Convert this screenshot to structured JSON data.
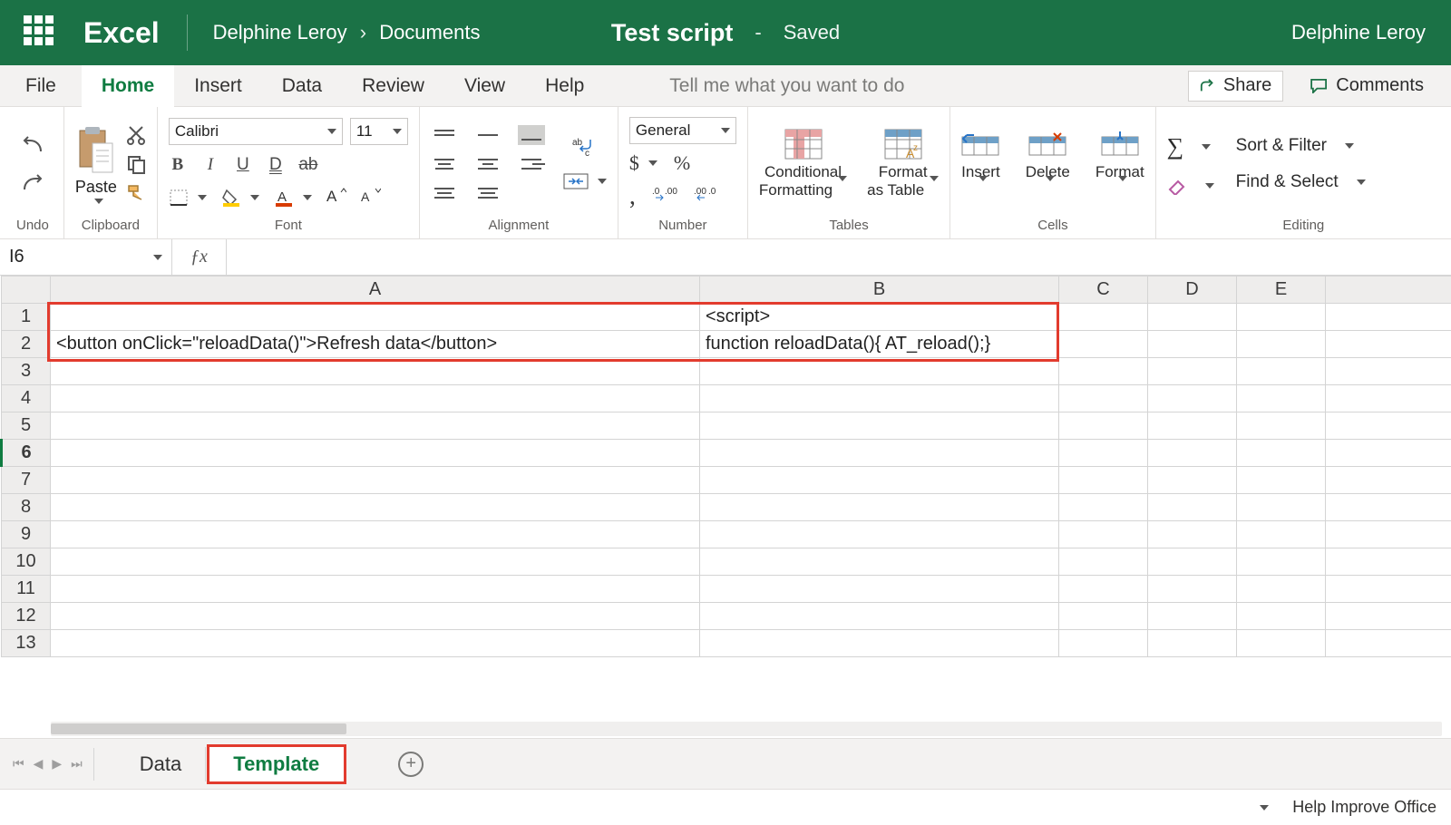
{
  "titlebar": {
    "app": "Excel",
    "user_left": "Delphine Leroy",
    "crumb_sep": "›",
    "crumb_folder": "Documents",
    "filename": "Test script",
    "dash": "-",
    "saved": "Saved",
    "user_right": "Delphine Leroy"
  },
  "tabs": {
    "file": "File",
    "home": "Home",
    "insert": "Insert",
    "data": "Data",
    "review": "Review",
    "view": "View",
    "help": "Help",
    "tellme": "Tell me what you want to do",
    "share": "Share",
    "comments": "Comments"
  },
  "ribbon": {
    "undo_label": "Undo",
    "clipboard_label": "Clipboard",
    "paste": "Paste",
    "font_label": "Font",
    "font_name": "Calibri",
    "font_size": "11",
    "alignment_label": "Alignment",
    "number_label": "Number",
    "number_format": "General",
    "dollar": "$",
    "percent": "%",
    "comma": ",",
    "tables_label": "Tables",
    "cond_fmt_a": "Conditional",
    "cond_fmt_b": "Formatting",
    "fmt_tbl_a": "Format",
    "fmt_tbl_b": "as Table",
    "cells_label": "Cells",
    "insert_cells": "Insert",
    "delete_cells": "Delete",
    "format_cells": "Format",
    "editing_label": "Editing",
    "sort_filter": "Sort & Filter",
    "find_select": "Find & Select"
  },
  "fxbar": {
    "namebox": "I6",
    "formula": ""
  },
  "columns": [
    "A",
    "B",
    "C",
    "D",
    "E"
  ],
  "rows": [
    "1",
    "2",
    "3",
    "4",
    "5",
    "6",
    "7",
    "8",
    "9",
    "10",
    "11",
    "12",
    "13"
  ],
  "selected_row": "6",
  "cells": {
    "B1": "<script>",
    "A2": "<button onClick=\"reloadData()\">Refresh data</button>",
    "B2": "function reloadData(){ AT_reload();}"
  },
  "sheettabs": {
    "data": "Data",
    "template": "Template",
    "add": "+"
  },
  "statusbar": {
    "help": "Help Improve Office"
  }
}
